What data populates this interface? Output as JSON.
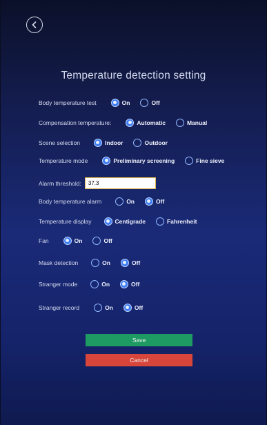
{
  "header": {
    "back_icon": "chevron-left-circle-icon",
    "title": "Temperature detection setting"
  },
  "settings": {
    "body_temp_test": {
      "label": "Body temperature test",
      "options": [
        "On",
        "Off"
      ],
      "selected": "On"
    },
    "compensation": {
      "label": "Compensation temperature:",
      "options": [
        "Automatic",
        "Manual"
      ],
      "selected": "Automatic"
    },
    "scene": {
      "label": "Scene selection",
      "options": [
        "Indoor",
        "Outdoor"
      ],
      "selected": "Indoor"
    },
    "temp_mode": {
      "label": "Temperature mode",
      "options": [
        "Preliminary screening",
        "Fine sieve"
      ],
      "selected": "Preliminary screening"
    },
    "alarm_threshold": {
      "label": "Alarm threshold:",
      "value": "37.3"
    },
    "body_temp_alarm": {
      "label": "Body temperature alarm",
      "options": [
        "On",
        "Off"
      ],
      "selected": "Off"
    },
    "temp_display": {
      "label": "Temperature display",
      "options": [
        "Centigrade",
        "Fahrenheit"
      ],
      "selected": "Centigrade"
    },
    "fan": {
      "label": "Fan",
      "options": [
        "On",
        "Off"
      ],
      "selected": "On"
    },
    "mask_detection": {
      "label": "Mask detection",
      "options": [
        "On",
        "Off"
      ],
      "selected": "Off"
    },
    "stranger_mode": {
      "label": "Stranger mode",
      "options": [
        "On",
        "Off"
      ],
      "selected": "Off"
    },
    "stranger_record": {
      "label": "Stranger record",
      "options": [
        "On",
        "Off"
      ],
      "selected": "Off"
    }
  },
  "buttons": {
    "save": "Save",
    "cancel": "Cancel"
  },
  "colors": {
    "save": "#1e9a63",
    "cancel": "#d8453a",
    "radio_checked": "#3f7df2"
  }
}
